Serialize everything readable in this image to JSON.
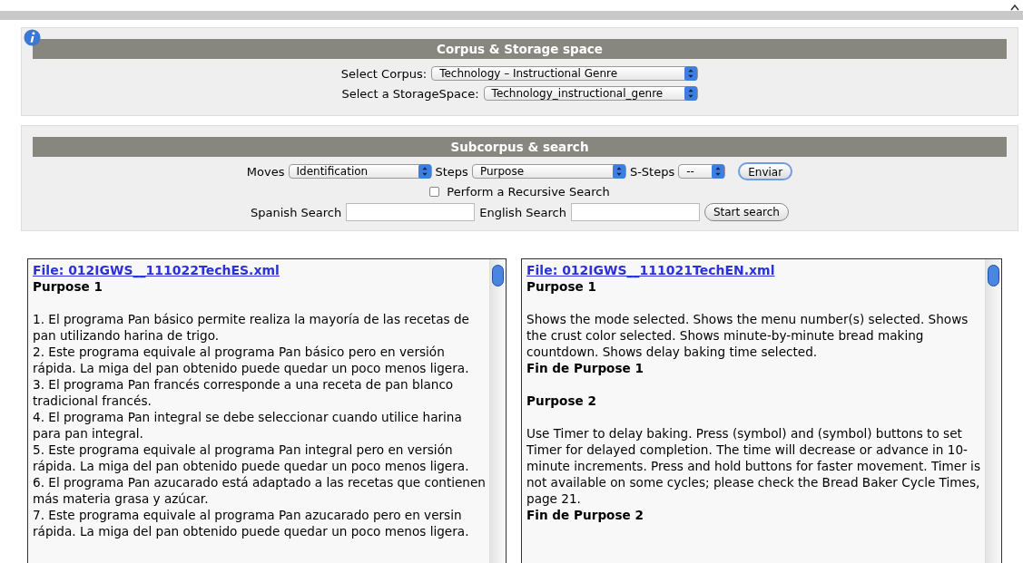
{
  "corpus_section": {
    "title": "Corpus & Storage space",
    "rows": [
      {
        "label": "Select Corpus:",
        "value": "Technology – Instructional Genre"
      },
      {
        "label": "Select a StorageSpace:",
        "value": "Technology_instructional_genre"
      }
    ]
  },
  "search_section": {
    "title": "Subcorpus & search",
    "filters": [
      {
        "label": "Moves",
        "value": "Identification"
      },
      {
        "label": "Steps",
        "value": "Purpose"
      },
      {
        "label": "S-Steps",
        "value": "--"
      }
    ],
    "submit_button": "Enviar",
    "recursive": {
      "label": "Perform a Recursive Search",
      "checked": false
    },
    "fields": [
      {
        "label": "Spanish Search"
      },
      {
        "label": "English Search"
      }
    ],
    "search_button": "Start search"
  },
  "panels": [
    {
      "file": "File: 012IGWS__111022TechES.xml",
      "blocks": [
        {
          "kind": "heading",
          "text": "Purpose 1"
        },
        {
          "kind": "gap"
        },
        {
          "kind": "text",
          "text": "1. El programa Pan básico permite realiza la mayoría de las recetas de pan utilizando harina de trigo."
        },
        {
          "kind": "text",
          "text": "2. Este programa equivale al programa Pan básico pero en versión rápida. La miga del pan obtenido puede quedar un poco menos ligera."
        },
        {
          "kind": "text",
          "text": "3. El programa Pan francés corresponde a una receta de pan blanco tradicional francés."
        },
        {
          "kind": "text",
          "text": "4. El programa Pan integral se debe seleccionar cuando utilice harina para pan integral."
        },
        {
          "kind": "text",
          "text": "5. Este programa equivale al programa Pan integral pero en versión rápida. La miga del pan obtenido puede quedar un poco menos ligera."
        },
        {
          "kind": "text",
          "text": "6. El programa Pan azucarado está adaptado a las recetas que contienen más materia grasa y azúcar."
        },
        {
          "kind": "text",
          "text": "7. Este programa equivale al programa Pan azucarado pero en versin rápida. La miga del pan obtenido puede quedar un poco menos ligera."
        }
      ]
    },
    {
      "file": "File: 012IGWS__111021TechEN.xml",
      "blocks": [
        {
          "kind": "heading",
          "text": "Purpose 1"
        },
        {
          "kind": "gap"
        },
        {
          "kind": "text",
          "text": "Shows the mode selected. Shows the menu number(s) selected. Shows the crust color selected. Shows minute-by-minute bread making countdown. Shows delay baking time selected."
        },
        {
          "kind": "heading",
          "text": "Fin de Purpose 1"
        },
        {
          "kind": "gap"
        },
        {
          "kind": "heading",
          "text": "Purpose 2"
        },
        {
          "kind": "gap"
        },
        {
          "kind": "text",
          "text": "Use Timer to delay baking. Press (symbol) and (symbol) buttons to set Timer for delayed completion. The time will decrease or advance in 10-minute increments. Press and hold buttons for faster movement. Timer is not available on some cycles; please check the Bread Baker Cycle Times, page 21."
        },
        {
          "kind": "heading",
          "text": "Fin de Purpose 2"
        }
      ]
    }
  ]
}
